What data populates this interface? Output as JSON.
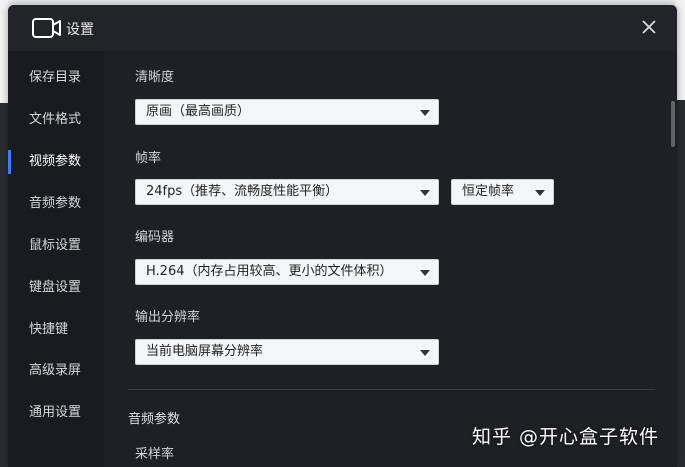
{
  "window": {
    "title": "设置"
  },
  "sidebar": {
    "items": [
      {
        "label": "保存目录"
      },
      {
        "label": "文件格式"
      },
      {
        "label": "视频参数"
      },
      {
        "label": "音频参数"
      },
      {
        "label": "鼠标设置"
      },
      {
        "label": "键盘设置"
      },
      {
        "label": "快捷键"
      },
      {
        "label": "高级录屏"
      },
      {
        "label": "通用设置"
      }
    ],
    "active_index": 2
  },
  "video": {
    "clarity": {
      "label": "清晰度",
      "value": "原画（最高画质）"
    },
    "framerate": {
      "label": "帧率",
      "value": "24fps（推荐、流畅度性能平衡）",
      "mode_value": "恒定帧率"
    },
    "encoder": {
      "label": "编码器",
      "value": "H.264（内存占用较高、更小的文件体积）"
    },
    "resolution": {
      "label": "输出分辨率",
      "value": "当前电脑屏幕分辨率"
    }
  },
  "audio": {
    "section_title": "音频参数",
    "samplerate": {
      "label": "采样率"
    }
  },
  "watermark": "知乎 @开心盒子软件",
  "colors": {
    "accent": "#3d7cff",
    "bg": "#1f2024",
    "sidebar": "#1a1b1e",
    "select_bg": "#f4f5f7"
  }
}
